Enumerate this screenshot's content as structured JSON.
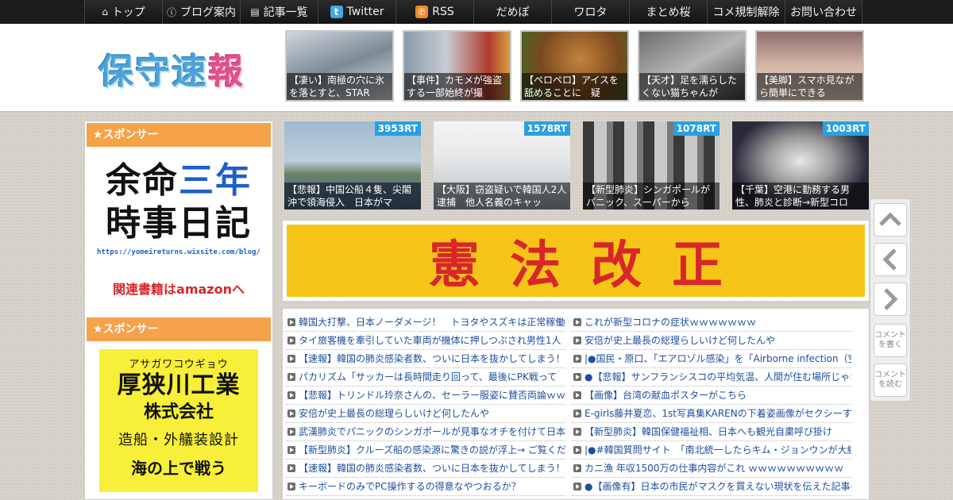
{
  "nav": {
    "items": [
      {
        "label": "トップ",
        "icon": "home-icon"
      },
      {
        "label": "ブログ案内",
        "icon": "info-icon"
      },
      {
        "label": "記事一覧",
        "icon": "list-icon"
      },
      {
        "label": "Twitter",
        "icon": "twitter-icon"
      },
      {
        "label": "RSS",
        "icon": "rss-icon"
      },
      {
        "label": "だめぽ"
      },
      {
        "label": "ワロタ"
      },
      {
        "label": "まとめ桜"
      },
      {
        "label": "コメ規制解除"
      },
      {
        "label": "お問い合わせ"
      }
    ]
  },
  "header": {
    "logo_a": "保守速",
    "logo_b": "報",
    "thumbs": [
      {
        "caption": "【凄い】南極の穴に氷を落とすと、STAR"
      },
      {
        "caption": "【事件】カモメが強盗する一部始終が撮"
      },
      {
        "caption": "【ペロペロ】アイスを舐めることに　疑"
      },
      {
        "caption": "【天才】足を濡らしたくない猫ちゃんが"
      },
      {
        "caption": "【美脚】スマホ見ながら簡単にできる"
      }
    ]
  },
  "sidebar": {
    "head1": "★スポンサー",
    "ad1": {
      "line1a": "余命",
      "line1b": "三年",
      "line2": "時事日記",
      "url": "https://yomeireturns.wixsite.com/blog/",
      "amazon": "関連書籍はamazonへ"
    },
    "head2": "★スポンサー",
    "ad2": {
      "kana": "アサガワコウギョウ",
      "name": "厚狭川工業",
      "suffix": "株式会社",
      "desc": "造船・外艤装設計",
      "motto": "海の上で戦う"
    }
  },
  "main_thumbs": [
    {
      "rt": "3953RT",
      "caption": "【悲報】中国公船４隻、尖閣沖で領海侵入　日本がマ"
    },
    {
      "rt": "1578RT",
      "caption": "【大阪】窃盗疑いで韓国人2人逮捕　他人名義のキャッ"
    },
    {
      "rt": "1078RT",
      "caption": "【新型肺炎】シンガポールがパニック、スーパーから"
    },
    {
      "rt": "1003RT",
      "caption": "【千葉】空港に勤務する男性、肺炎と診断→新型コロ"
    }
  ],
  "banner": {
    "text": "憲法改正"
  },
  "list_left": [
    "韓国大打撃、日本ノーダメージ！　トヨタやスズキは正常稼働",
    "タイ旅客機を牽引していた車両が機体に押しつぶされ男性1人",
    "【速報】韓国の肺炎感染者数、ついに日本を抜かしてしまう！",
    "パカリズム「サッカーは長時間走り回って、最後にPK戦って",
    "【悲報】トリンドル玲奈さんの、セーラー服姿に賛否両論ｗｗ",
    "安倍が史上最長の総理らしいけど何したんや",
    "武漢肺炎でパニックのシンガポールが見事なオチを付けて日本",
    "【新型肺炎】クルーズ船の感染源に驚きの説が浮上→ ご覧くだ",
    "【速報】韓国の肺炎感染者数、ついに日本を抜かしてしまう！",
    "キーボードのみでPC操作するの得意なやつおるか？"
  ],
  "list_right": [
    "これが新型コロナの症状ｗｗｗｗｗｗｗ",
    "安倍が史上最長の総理らしいけど何したんや",
    "|●国民・原口、「エアロゾル感染」を「Airborne infection（空気",
    "●【悲報】サンフランシスコの平均気温、人間が住む場所じゃな",
    "【画像】台湾の献血ポスターがこちら",
    "E-girls藤井夏恋、1st写真集KARENの下着姿画像がセクシーすぎ",
    "【新型肺炎】韓国保健福祉相、日本へも観光自粛呼び掛け",
    "|●#韓国質問サイト　「南北統一したらキム・ジョンウンが大統",
    "カニ漁 年収1500万の仕事内容がこれ ｗｗｗｗｗｗｗｗｗｗ",
    "●【画像有】日本の市民がマスクを買えない現状を伝えた記事の"
  ],
  "float": {
    "comment_write": "コメントを書く",
    "comment_read": "コメントを読む"
  },
  "colors": {
    "accent": "#f5a24a",
    "rt_badge": "#2aa0e0",
    "banner_bg": "#f5c518",
    "banner_text": "#d8262b",
    "link": "#1d4fa0"
  }
}
